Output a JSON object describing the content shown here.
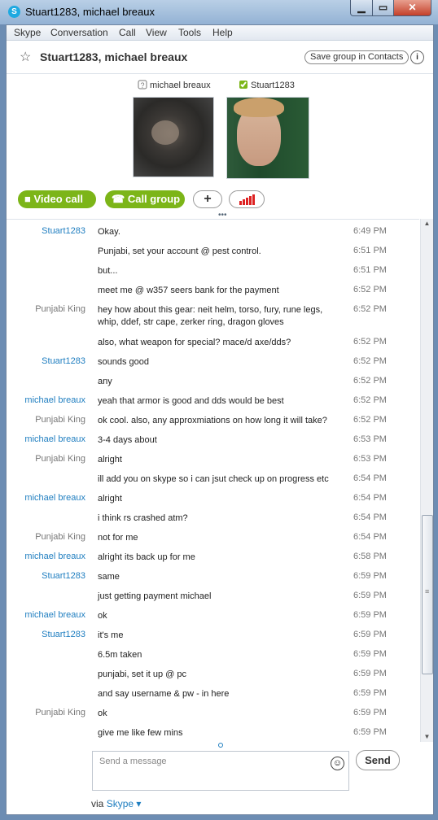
{
  "window": {
    "title": "Stuart1283, michael breaux",
    "app_icon": "skype-icon"
  },
  "menu": [
    "Skype",
    "Conversation",
    "Call",
    "View",
    "Tools",
    "Help"
  ],
  "conversation": {
    "title": "Stuart1283, michael breaux",
    "save_label": "Save group in Contacts",
    "info_label": "i"
  },
  "participants": [
    {
      "name": "michael breaux",
      "status_icon": "unknown-status-icon"
    },
    {
      "name": "Stuart1283",
      "status_icon": "online-check-icon"
    }
  ],
  "calls": {
    "video_label": "Video call",
    "group_label": "Call group",
    "add_label": "+",
    "signal_icon": "call-quality-icon"
  },
  "chat": [
    {
      "sender": "Stuart1283",
      "text": "Okay.",
      "time": "6:49 PM"
    },
    {
      "sender": "",
      "text": "Punjabi, set your account @ pest control.",
      "time": "6:51 PM"
    },
    {
      "sender": "",
      "text": "but...",
      "time": "6:51 PM"
    },
    {
      "sender": "",
      "text": "meet me @ w357 seers bank for the payment",
      "time": "6:52 PM"
    },
    {
      "sender": "Punjabi King",
      "text": "hey how about this gear: neit helm, torso, fury, rune legs, whip, ddef, str cape, zerker ring, dragon gloves",
      "time": "6:52 PM"
    },
    {
      "sender": "",
      "text": "also, what weapon for special? mace/d axe/dds?",
      "time": "6:52 PM"
    },
    {
      "sender": "Stuart1283",
      "text": "sounds good",
      "time": "6:52 PM"
    },
    {
      "sender": "",
      "text": "any",
      "time": "6:52 PM"
    },
    {
      "sender": "michael breaux",
      "text": "yeah that armor is good and dds would be best",
      "time": "6:52 PM"
    },
    {
      "sender": "Punjabi King",
      "text": "ok cool. also, any approxmiations on how long it will take?",
      "time": "6:52 PM"
    },
    {
      "sender": "michael breaux",
      "text": "3-4 days about",
      "time": "6:53 PM"
    },
    {
      "sender": "Punjabi King",
      "text": "alright",
      "time": "6:53 PM"
    },
    {
      "sender": "",
      "text": "ill add you on skype so i can jsut check up on progress etc",
      "time": "6:54 PM"
    },
    {
      "sender": "michael breaux",
      "text": "alright",
      "time": "6:54 PM"
    },
    {
      "sender": "",
      "text": "i think rs crashed atm?",
      "time": "6:54 PM"
    },
    {
      "sender": "Punjabi King",
      "text": "not for me",
      "time": "6:54 PM"
    },
    {
      "sender": "michael breaux",
      "text": "alright its back up for me",
      "time": "6:58 PM"
    },
    {
      "sender": "Stuart1283",
      "text": "same",
      "time": "6:59 PM"
    },
    {
      "sender": "",
      "text": "just getting payment michael",
      "time": "6:59 PM"
    },
    {
      "sender": "michael breaux",
      "text": "ok",
      "time": "6:59 PM"
    },
    {
      "sender": "Stuart1283",
      "text": "it's me",
      "time": "6:59 PM"
    },
    {
      "sender": "",
      "text": "6.5m taken",
      "time": "6:59 PM"
    },
    {
      "sender": "",
      "text": "punjabi, set it up @ pc",
      "time": "6:59 PM"
    },
    {
      "sender": "",
      "text": "and say username & pw - in here",
      "time": "6:59 PM"
    },
    {
      "sender": "Punjabi King",
      "text": "ok",
      "time": "6:59 PM"
    },
    {
      "sender": "",
      "text": "give me like few mins",
      "time": "6:59 PM"
    }
  ],
  "composer": {
    "placeholder": "Send a message",
    "send_label": "Send",
    "via_prefix": "via",
    "via_link": "Skype ▾"
  },
  "colors": {
    "accent_green": "#7cb518",
    "link_blue": "#1f7ec0",
    "muted_gray": "#777777"
  }
}
